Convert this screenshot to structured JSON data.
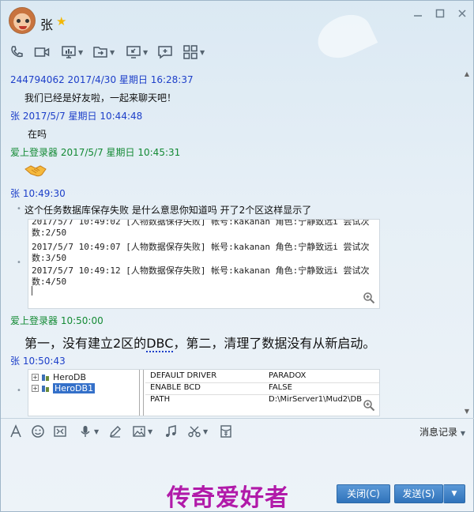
{
  "window": {
    "contact_name": "张",
    "star_glyph": "★",
    "controls": [
      "minimize",
      "maximize",
      "close"
    ]
  },
  "toolbar": {
    "icons": [
      "phone-icon",
      "video-icon",
      "screen-share-icon",
      "file-transfer-icon",
      "remote-assist-icon",
      "new-chat-icon",
      "apps-icon"
    ]
  },
  "messages": [
    {
      "sender": "244794062",
      "time": "2017/4/30 星期日 16:28:37",
      "text": "我们已经是好友啦，一起来聊天吧！"
    },
    {
      "sender": "张",
      "time": "2017/5/7 星期日 10:44:48",
      "text": "在吗"
    },
    {
      "sender": "爱上登录器",
      "time": "2017/5/7 星期日 10:45:31",
      "text": ""
    },
    {
      "sender": "张",
      "time": "10:49:30",
      "text": "这个任务数据库保存失败 是什么意思你知道吗    开了2个区这样显示了"
    },
    {
      "sender": "爱上登录器",
      "time": "10:50:00",
      "text_parts": [
        "第一，没有建立2区的",
        "DBC",
        "，第二，清理了数据没有从新启动。"
      ]
    },
    {
      "sender": "张",
      "time": "10:50:43",
      "text": ""
    }
  ],
  "screenshot1": {
    "lines": [
      "2017/5/7 10:49:02 [人物数据保存失败] 帐号:kakanan 角色:宁静致远i 尝试次",
      "数:2/50",
      "2017/5/7 10:49:07 [人物数据保存失败] 帐号:kakanan 角色:宁静致远i 尝试次",
      "数:3/50",
      "2017/5/7 10:49:12 [人物数据保存失败] 帐号:kakanan 角色:宁静致远i 尝试次",
      "数:4/50"
    ]
  },
  "screenshot2": {
    "tree": [
      "HeroDB",
      "HeroDB1"
    ],
    "properties": [
      {
        "key": "DEFAULT DRIVER",
        "value": "PARADOX"
      },
      {
        "key": "ENABLE BCD",
        "value": "FALSE"
      },
      {
        "key": "PATH",
        "value": "D:\\MirServer1\\Mud2\\DB"
      }
    ]
  },
  "input_toolbar": {
    "history_label": "消息记录",
    "icons": [
      "font-icon",
      "emoji-icon",
      "gif-icon",
      "voice-icon",
      "pen-icon",
      "image-icon",
      "music-icon",
      "scissors-icon",
      "red-packet-icon"
    ]
  },
  "footer": {
    "watermark": "传奇爱好者",
    "close_label": "关闭(C)",
    "send_label": "发送(S)"
  },
  "colors": {
    "sender_blue": "#1d3fc9",
    "sender_green": "#138a34",
    "button_blue": "#2f73bb",
    "watermark": "#b11aa9"
  }
}
